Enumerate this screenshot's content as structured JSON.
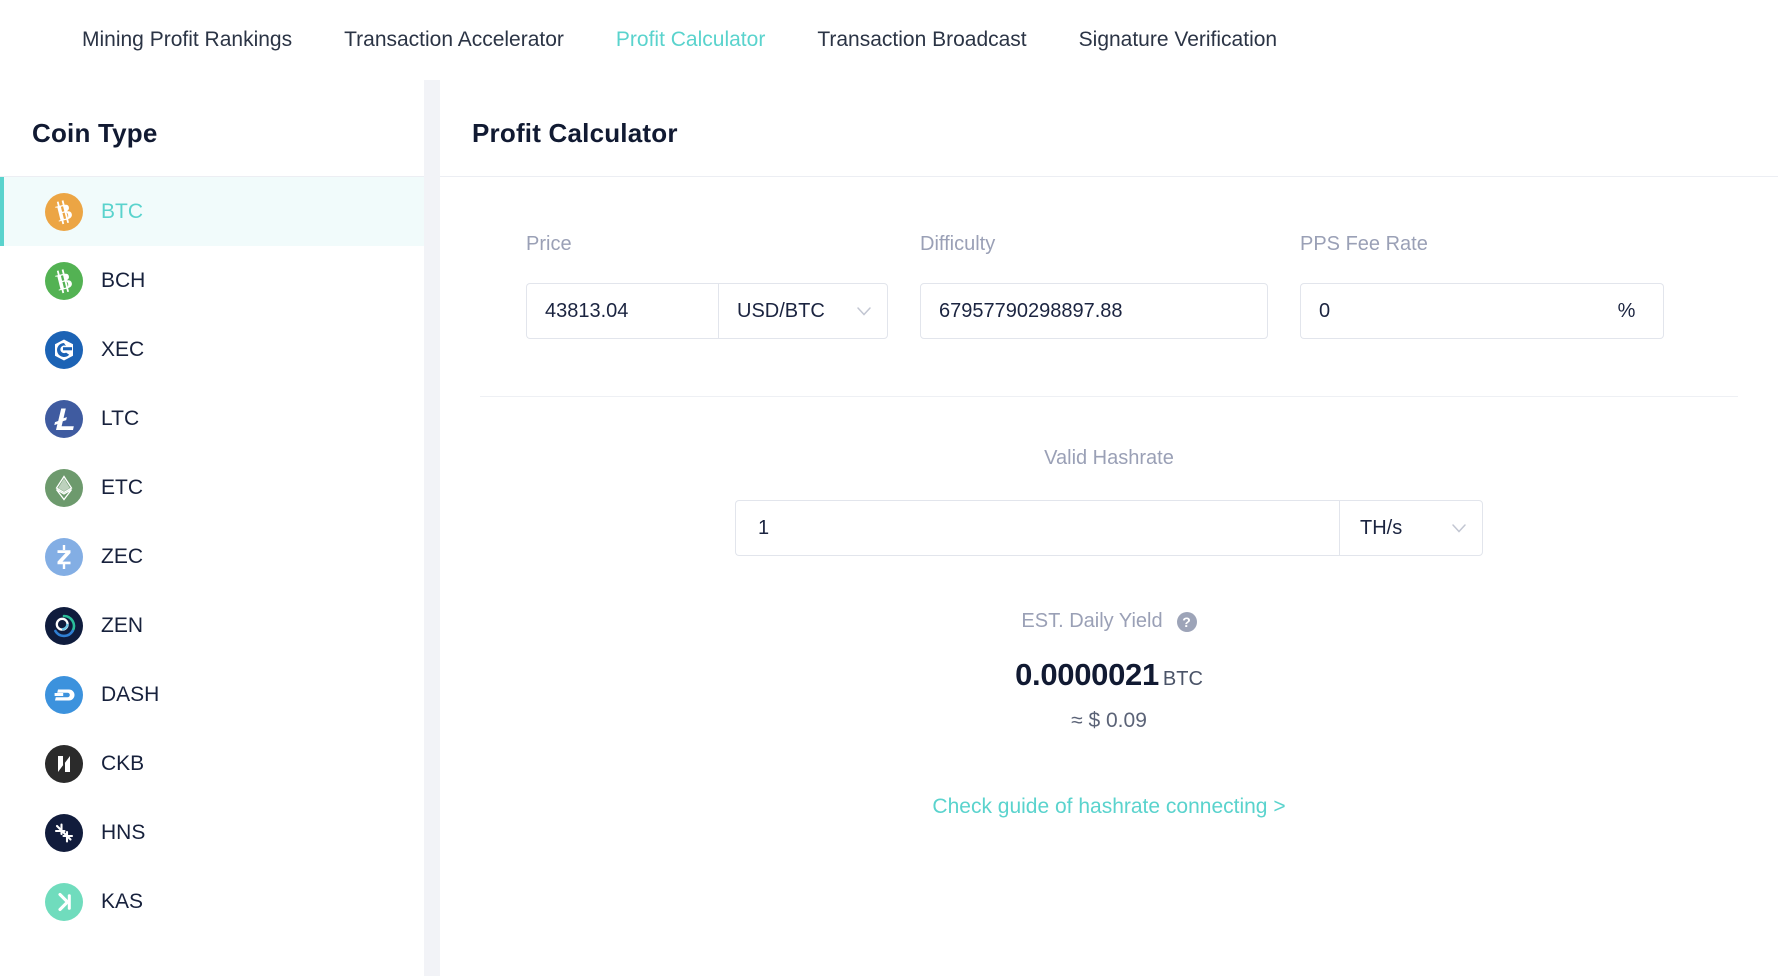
{
  "tabs": [
    {
      "label": "Mining Profit Rankings",
      "active": false
    },
    {
      "label": "Transaction Accelerator",
      "active": false
    },
    {
      "label": "Profit Calculator",
      "active": true
    },
    {
      "label": "Transaction Broadcast",
      "active": false
    },
    {
      "label": "Signature Verification",
      "active": false
    }
  ],
  "sidebar": {
    "title": "Coin Type",
    "items": [
      {
        "label": "BTC",
        "icon": "btc-coin-icon",
        "active": true
      },
      {
        "label": "BCH",
        "icon": "bch-coin-icon",
        "active": false
      },
      {
        "label": "XEC",
        "icon": "xec-coin-icon",
        "active": false
      },
      {
        "label": "LTC",
        "icon": "ltc-coin-icon",
        "active": false
      },
      {
        "label": "ETC",
        "icon": "etc-coin-icon",
        "active": false
      },
      {
        "label": "ZEC",
        "icon": "zec-coin-icon",
        "active": false
      },
      {
        "label": "ZEN",
        "icon": "zen-coin-icon",
        "active": false
      },
      {
        "label": "DASH",
        "icon": "dash-coin-icon",
        "active": false
      },
      {
        "label": "CKB",
        "icon": "ckb-coin-icon",
        "active": false
      },
      {
        "label": "HNS",
        "icon": "hns-coin-icon",
        "active": false
      },
      {
        "label": "KAS",
        "icon": "kas-coin-icon",
        "active": false
      }
    ]
  },
  "main": {
    "title": "Profit Calculator",
    "price": {
      "label": "Price",
      "value": "43813.04",
      "pair": "USD/BTC"
    },
    "difficulty": {
      "label": "Difficulty",
      "value": "67957790298897.88"
    },
    "pps_fee_rate": {
      "label": "PPS Fee Rate",
      "value": "0",
      "unit": "%"
    },
    "hashrate": {
      "label": "Valid Hashrate",
      "value": "1",
      "unit": "TH/s"
    },
    "yield": {
      "label": "EST. Daily Yield",
      "help": "?",
      "amount": "0.0000021",
      "currency": "BTC",
      "fiat": "≈ $ 0.09"
    },
    "guide_link": "Check guide of hashrate connecting >"
  },
  "colors": {
    "accent": "#5ad3cd",
    "active_row_bg": "#f1fbfb",
    "text_dark": "#111a32",
    "text_muted": "#9aa0b6",
    "page_bg": "#f2f3f7"
  }
}
